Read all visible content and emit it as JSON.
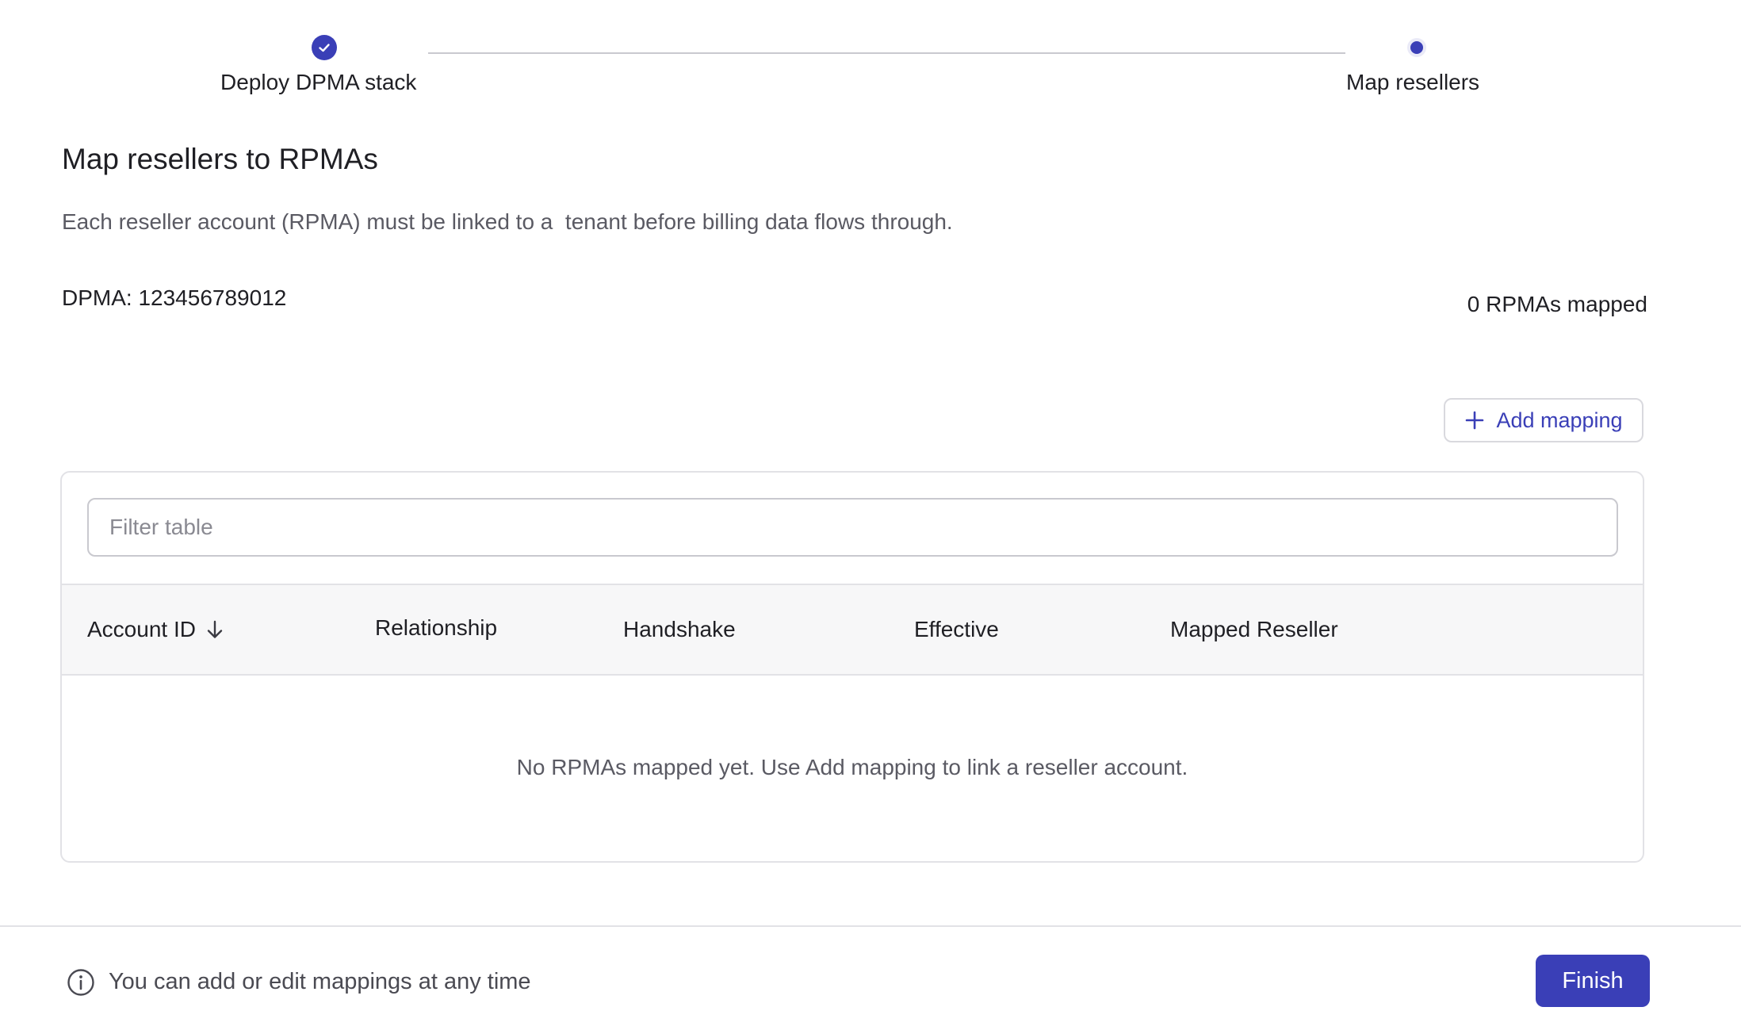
{
  "stepper": {
    "steps": [
      {
        "label": "Deploy DPMA stack",
        "state": "complete"
      },
      {
        "label": "Map resellers",
        "state": "current"
      }
    ]
  },
  "header": {
    "title": "Map resellers to RPMAs",
    "description": "Each reseller account (RPMA) must be linked to a  tenant before billing data flows through."
  },
  "dpma": {
    "label": "DPMA:",
    "id": "123456789012",
    "mapped_count": "0 RPMAs mapped"
  },
  "actions": {
    "add_mapping_label": "Add mapping"
  },
  "table": {
    "filter_placeholder": "Filter table",
    "columns": [
      "Account ID",
      "Relationship",
      "Handshake",
      "Effective",
      "Mapped Reseller"
    ],
    "sort_column": "Account ID",
    "sort_direction": "descending",
    "empty_message": "No RPMAs mapped yet. Use Add mapping to link a reseller account."
  },
  "footer": {
    "note": "You can add or edit mappings at any time",
    "finish_label": "Finish"
  },
  "colors": {
    "accent": "#3a3fb7",
    "border": "#e2e2e6",
    "header_bg": "#f7f7f8"
  }
}
